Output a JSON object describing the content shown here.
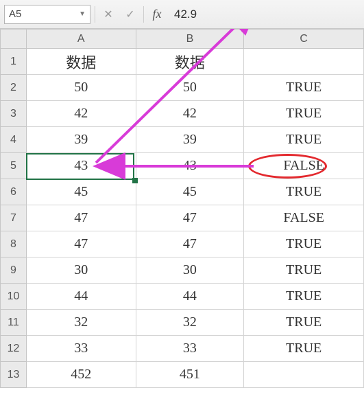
{
  "formula_bar": {
    "name_box": "A5",
    "cancel": "✕",
    "confirm": "✓",
    "fx": "fx",
    "value": "42.9"
  },
  "columns": [
    "A",
    "B",
    "C"
  ],
  "rows": [
    {
      "n": "1",
      "a": "数据",
      "b": "数据",
      "c": ""
    },
    {
      "n": "2",
      "a": "50",
      "b": "50",
      "c": "TRUE"
    },
    {
      "n": "3",
      "a": "42",
      "b": "42",
      "c": "TRUE"
    },
    {
      "n": "4",
      "a": "39",
      "b": "39",
      "c": "TRUE"
    },
    {
      "n": "5",
      "a": "43",
      "b": "43",
      "c": "FALSE"
    },
    {
      "n": "6",
      "a": "45",
      "b": "45",
      "c": "TRUE"
    },
    {
      "n": "7",
      "a": "47",
      "b": "47",
      "c": "FALSE"
    },
    {
      "n": "8",
      "a": "47",
      "b": "47",
      "c": "TRUE"
    },
    {
      "n": "9",
      "a": "30",
      "b": "30",
      "c": "TRUE"
    },
    {
      "n": "10",
      "a": "44",
      "b": "44",
      "c": "TRUE"
    },
    {
      "n": "11",
      "a": "32",
      "b": "32",
      "c": "TRUE"
    },
    {
      "n": "12",
      "a": "33",
      "b": "33",
      "c": "TRUE"
    },
    {
      "n": "13",
      "a": "452",
      "b": "451",
      "c": ""
    }
  ],
  "active_cell": "A5",
  "circled_cell": "C5",
  "annotations": {
    "arrow_color": "#d83bd8"
  }
}
